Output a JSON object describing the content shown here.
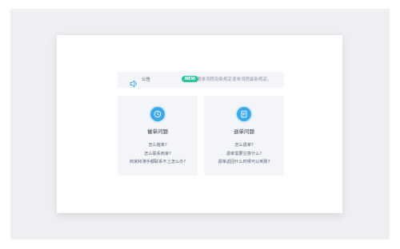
{
  "notice": {
    "icon": "speaker-icon",
    "label": "公告",
    "badge": "NEW",
    "text": "退单流程及新规定退单流程最新规定。"
  },
  "cards": [
    {
      "icon": "clock-icon",
      "title": "催单问题",
      "items": [
        "怎么催单?",
        "怎么联系商家?",
        "商家和骑手都联系不上怎么办?"
      ]
    },
    {
      "icon": "document-icon",
      "title": "退单问题",
      "items": [
        "怎么退单?",
        "退单需要注意什么?",
        "退单返回什么时候可以到账?"
      ]
    }
  ],
  "colors": {
    "accent": "#3ba8ea",
    "badge": "#2ec4a0",
    "card_bg": "#f4f5f8",
    "backdrop": "#efeff3"
  }
}
